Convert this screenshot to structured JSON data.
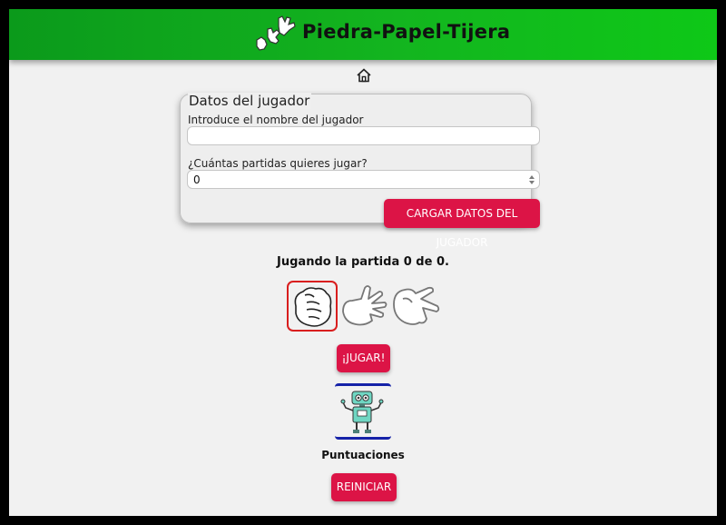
{
  "header": {
    "title": "Piedra-Papel-Tijera",
    "logo_icon": "hands-icon"
  },
  "nav": {
    "home_icon": "home-icon"
  },
  "player_form": {
    "legend": "Datos del jugador",
    "name_label": "Introduce el nombre del jugador",
    "name_value": "",
    "games_label": "¿Cuántas partidas quieres jugar?",
    "games_value": "0",
    "load_button": "CARGAR DATOS DEL JUGADOR"
  },
  "game": {
    "status": "Jugando la partida 0 de 0.",
    "choices": [
      "rock-hand-icon",
      "paper-hand-icon",
      "scissors-hand-icon"
    ],
    "selected": "rock-hand-icon",
    "play_button": "¡JUGAR!",
    "opponent_icon": "robot-icon"
  },
  "scores": {
    "title": "Puntuaciones",
    "reset_button": "REINICIAR"
  },
  "colors": {
    "header_green": "#13b51f",
    "accent_red": "#dc1446",
    "select_border": "#d91e1e",
    "robot_frame": "#1522a8"
  }
}
